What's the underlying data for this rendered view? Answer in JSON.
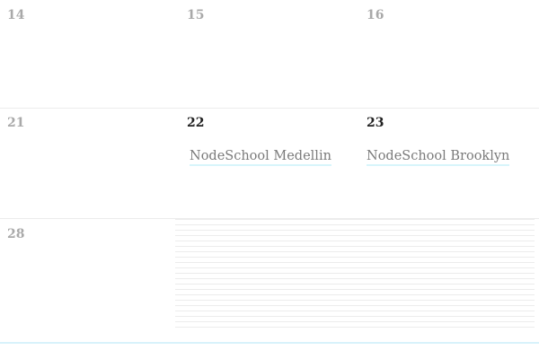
{
  "calendar": {
    "rows": [
      {
        "days": [
          {
            "num": "14"
          },
          {
            "num": "15"
          },
          {
            "num": "16"
          }
        ]
      },
      {
        "days": [
          {
            "num": "21"
          },
          {
            "num": "22",
            "event": "NodeSchool Medellin"
          },
          {
            "num": "23",
            "event": "NodeSchool Brooklyn"
          }
        ]
      },
      {
        "days": [
          {
            "num": "28"
          }
        ]
      }
    ],
    "colors": {
      "muted": "#a9a9a9",
      "active": "#222222",
      "event_underline": "#d8f5fb"
    }
  }
}
